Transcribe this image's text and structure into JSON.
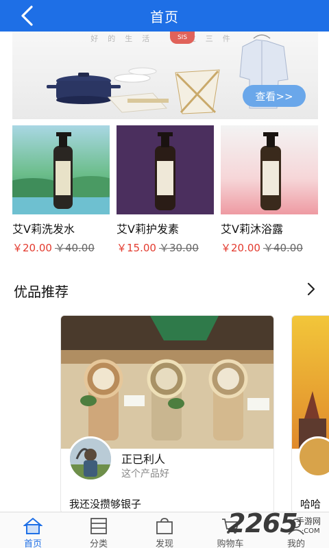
{
  "header": {
    "title": "首页"
  },
  "banner": {
    "slogan": "好的生活 不过三件",
    "logo_text": "SIS",
    "button_label": "查看>>"
  },
  "products": [
    {
      "name": "艾V莉洗发水",
      "price": "￥20.00",
      "old_price": "￥40.00"
    },
    {
      "name": "艾V莉护发素",
      "price": "￥15.00",
      "old_price": "￥30.00"
    },
    {
      "name": "艾V莉沐浴露",
      "price": "￥20.00",
      "old_price": "￥40.00"
    }
  ],
  "recommend": {
    "title": "优品推荐",
    "cards": [
      {
        "user": "正已利人",
        "subtitle": "这个产品好",
        "text": "我还没攒够银子"
      },
      {
        "text": "哈哈"
      }
    ]
  },
  "tabbar": {
    "items": [
      {
        "label": "首页",
        "icon": "home-icon",
        "active": true
      },
      {
        "label": "分类",
        "icon": "category-icon",
        "active": false
      },
      {
        "label": "发现",
        "icon": "discover-icon",
        "active": false
      },
      {
        "label": "购物车",
        "icon": "cart-icon",
        "active": false
      },
      {
        "label": "我的",
        "icon": "profile-icon",
        "active": false
      }
    ]
  },
  "watermark": {
    "number": "2265",
    "suffix_cn": "手游网",
    "suffix_en": "·COM"
  },
  "colors": {
    "primary": "#1e6fe6",
    "price": "#e33a2e"
  }
}
